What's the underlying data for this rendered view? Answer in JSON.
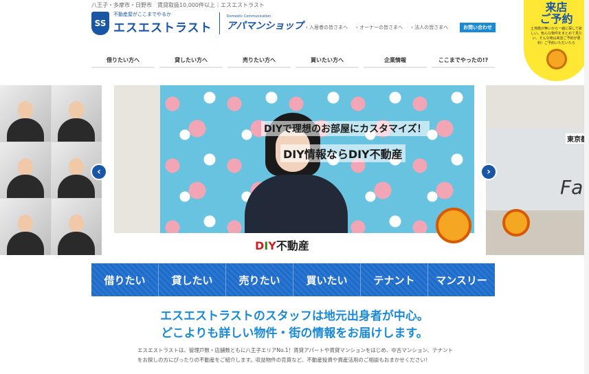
{
  "header": {
    "topline": "八王子・多摩市・日野市　賃貸取扱10,000件以上｜エスエストラスト",
    "logo_tagline": "不動産屋がここまでやるか",
    "logo_name": "エスエストラスト",
    "logo_mark": "SS",
    "apaman_small": "Domestic Communication",
    "apaman_name": "アパマンショップ",
    "links": [
      "入居者の皆さまへ",
      "オーナーの皆さまへ",
      "法人の皆さまへ"
    ],
    "contact_label": "お問い合わせ"
  },
  "badge": {
    "title1": "来店",
    "title2": "ご予約",
    "text": "土地勘が無いから一緒に探して欲しい。色んな物件をまとめて見たい。そんな時は来店ご予約が便利！ご予約いただいたら"
  },
  "nav": {
    "items": [
      "借りたい方へ",
      "貸したい方へ",
      "売りたい方へ",
      "買いたい方へ",
      "企業情報",
      "ここまでやったの!?"
    ]
  },
  "carousel": {
    "text1": "DIYで理想のお部屋にカスタマイズ！",
    "text2": "DIY情報ならDIY不動産",
    "logo_d": "D",
    "logo_i": "I",
    "logo_y": "Y",
    "logo_rest": "不動産",
    "right_text": "東京都",
    "right_big": "Fa",
    "prev": "‹",
    "next": "›"
  },
  "categories": [
    "借りたい",
    "貸したい",
    "売りたい",
    "買いたい",
    "テナント",
    "マンスリー"
  ],
  "intro": {
    "headline1": "エスエストラストのスタッフは地元出身者が中心。",
    "headline2": "どこよりも詳しい物件・街の情報をお届けします。",
    "body": "エスエストラストは、管理戸数・店舗数ともに八王子エリアNo.1！賃貸アパートや賃貸マンションをはじめ、中古マンション、テナントをお探しの方にぴったりの不動産をご紹介します。収益物件の売買など、不動産投資や資産活用のご相談もおまかせください！"
  },
  "colors": {
    "brand_blue": "#1a56a6",
    "accent_blue": "#1a8ad6",
    "badge_yellow": "#ffe833"
  }
}
